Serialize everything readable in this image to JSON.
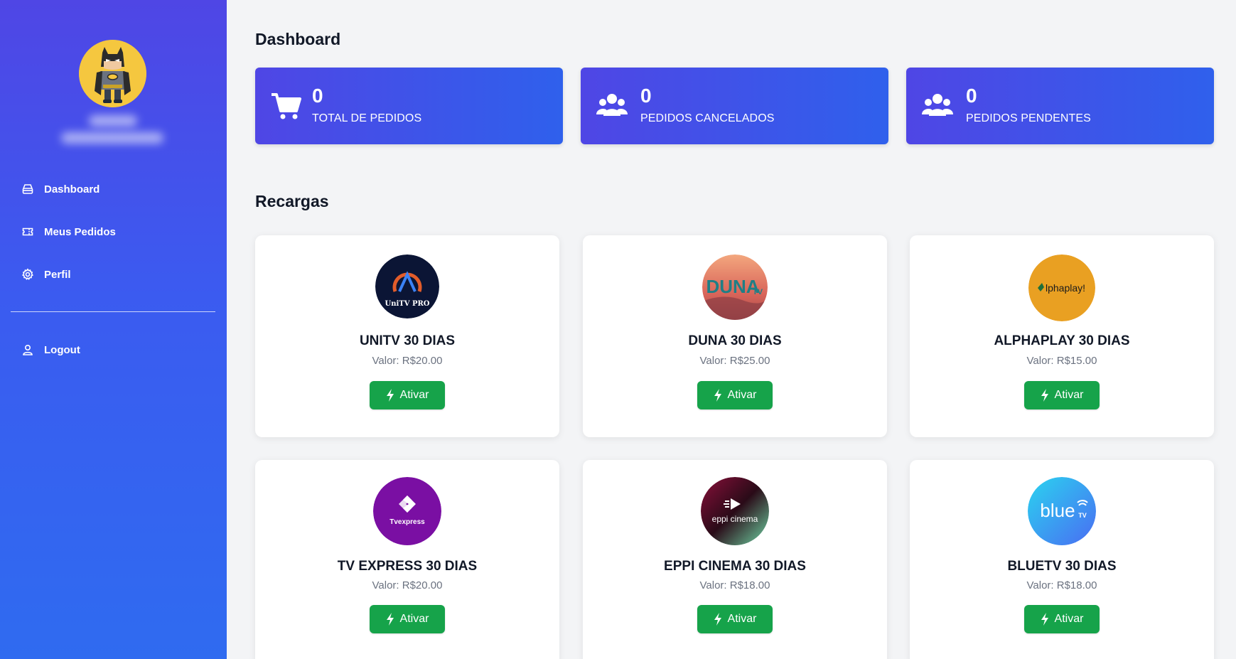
{
  "sidebar": {
    "items": [
      {
        "label": "Dashboard",
        "icon": "inbox-icon"
      },
      {
        "label": "Meus Pedidos",
        "icon": "ticket-icon"
      },
      {
        "label": "Perfil",
        "icon": "gear-icon"
      }
    ],
    "logout_label": "Logout"
  },
  "dashboard": {
    "title": "Dashboard",
    "stats": [
      {
        "value": "0",
        "label": "TOTAL DE PEDIDOS",
        "icon": "cart-icon"
      },
      {
        "value": "0",
        "label": "PEDIDOS CANCELADOS",
        "icon": "users-icon"
      },
      {
        "value": "0",
        "label": "PEDIDOS PENDENTES",
        "icon": "users-icon"
      }
    ]
  },
  "recargas": {
    "title": "Recargas",
    "button_label": "Ativar",
    "products": [
      {
        "name": "UNITV 30 DIAS",
        "price": "Valor: R$20.00",
        "logo_text": "UniTV PRO",
        "logo_color": "#0b1535"
      },
      {
        "name": "DUNA 30 DIAS",
        "price": "Valor: R$25.00",
        "logo_text": "DUNA",
        "logo_text2": "TV",
        "logo_color": "#e7856a"
      },
      {
        "name": "ALPHAPLAY 30 DIAS",
        "price": "Valor: R$15.00",
        "logo_text": "lphaplay!",
        "logo_color": "#e9a022"
      },
      {
        "name": "TV EXPRESS 30 DIAS",
        "price": "Valor: R$20.00",
        "logo_text": "Tvexpress",
        "logo_color": "#7a0fa3"
      },
      {
        "name": "EPPI CINEMA 30 DIAS",
        "price": "Valor: R$18.00",
        "logo_text": "eppi cinema",
        "logo_color": "#3b0d20"
      },
      {
        "name": "BLUETV 30 DIAS",
        "price": "Valor: R$18.00",
        "logo_text": "blue",
        "logo_text2": "TV",
        "logo_color": "#3b9af0"
      }
    ]
  }
}
